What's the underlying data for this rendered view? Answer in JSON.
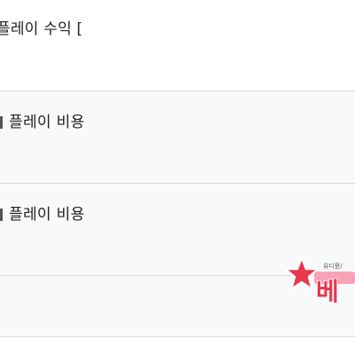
{
  "header": {
    "text": "플레이 수익 ["
  },
  "rows": [
    {
      "label": "플레이 비용"
    },
    {
      "label": "플레이 비용"
    },
    {
      "label": ""
    }
  ],
  "colors": {
    "row_background": "#f8f9fa",
    "divider": "#d8dadd",
    "watermark_red": "#e8384d",
    "watermark_pink": "#f7a3b8"
  },
  "watermark": {
    "text": "베",
    "subtext": "유디뮨/"
  }
}
